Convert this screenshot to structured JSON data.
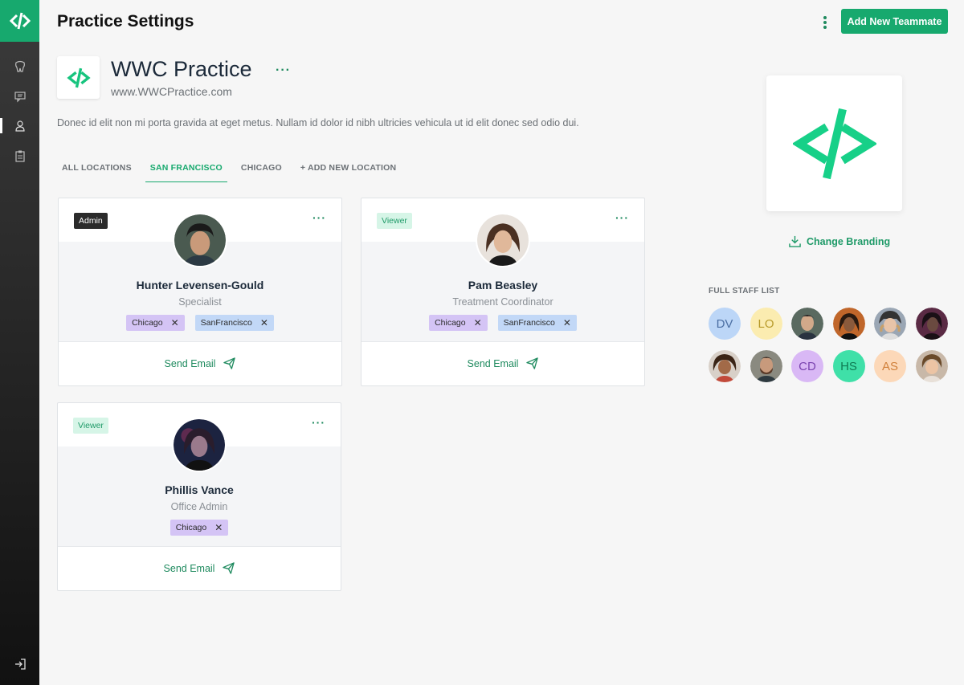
{
  "app": {
    "page_title": "Practice Settings",
    "add_button_label": "Add New Teammate"
  },
  "sidebar": {
    "items": [
      {
        "icon": "tooth-icon"
      },
      {
        "icon": "chat-icon"
      },
      {
        "icon": "user-icon",
        "active": true
      },
      {
        "icon": "clipboard-icon"
      }
    ],
    "logout_icon": "logout-icon"
  },
  "practice": {
    "name": "WWC Practice",
    "url": "www.WWCPractice.com",
    "more_label": "···",
    "description": "Donec id elit non mi porta gravida at eget metus. Nullam id dolor id nibh ultricies vehicula ut id elit donec sed odio dui."
  },
  "tabs": [
    {
      "label": "ALL LOCATIONS",
      "active": false
    },
    {
      "label": "SAN FRANCISCO",
      "active": true
    },
    {
      "label": "CHICAGO",
      "active": false
    },
    {
      "label": "+ ADD NEW LOCATION",
      "active": false
    }
  ],
  "cards": [
    {
      "role": "Admin",
      "name": "Hunter Levensen-Gould",
      "title": "Specialist",
      "more_label": "···",
      "chips": [
        "Chicago",
        "SanFrancisco"
      ],
      "action_label": "Send Email"
    },
    {
      "role": "Viewer",
      "name": "Pam Beasley",
      "title": "Treatment Coordinator",
      "more_label": "···",
      "chips": [
        "Chicago",
        "SanFrancisco"
      ],
      "action_label": "Send Email"
    },
    {
      "role": "Viewer",
      "name": "Phillis Vance",
      "title": "Office Admin",
      "more_label": "···",
      "chips": [
        "Chicago"
      ],
      "action_label": "Send Email"
    }
  ],
  "branding": {
    "change_label": "Change Branding"
  },
  "staff": {
    "label": "FULL STAFF LIST",
    "members": [
      {
        "initials": "DV"
      },
      {
        "initials": "LO"
      },
      {
        "initials": ""
      },
      {
        "initials": ""
      },
      {
        "initials": ""
      },
      {
        "initials": ""
      },
      {
        "initials": ""
      },
      {
        "initials": ""
      },
      {
        "initials": "CD"
      },
      {
        "initials": "HS"
      },
      {
        "initials": "AS"
      },
      {
        "initials": ""
      }
    ]
  },
  "colors": {
    "accent": "#17a96e",
    "chip_chicago": "#d4c4f5",
    "chip_sanfrancisco": "#c2d8f7",
    "viewer_badge": "#d6f5e7",
    "admin_badge": "#2b2b2b"
  }
}
